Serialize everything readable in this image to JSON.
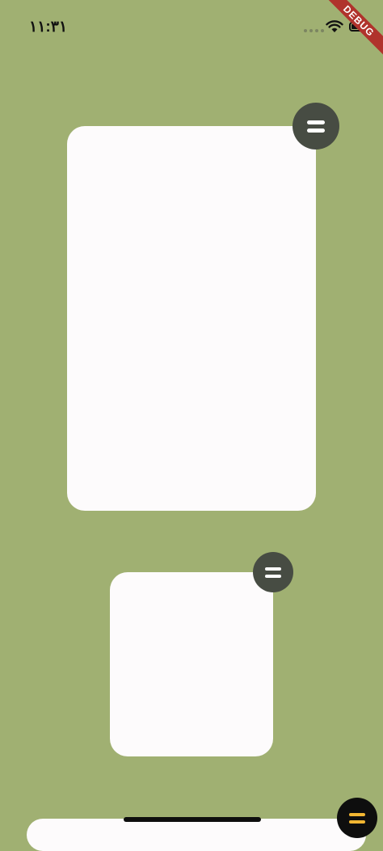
{
  "status_bar": {
    "time": "١١:٣١",
    "signal_icon": "cellular-dots-icon",
    "wifi_icon": "wifi-icon",
    "battery_icon": "battery-icon"
  },
  "debug_banner": {
    "label": "DEBUG"
  },
  "cards": [
    {
      "name": "large-card",
      "handle_icon": "drag-handle-icon"
    },
    {
      "name": "small-card",
      "handle_icon": "drag-handle-icon"
    },
    {
      "name": "bottom-card",
      "handle_icon": "drag-handle-icon"
    }
  ],
  "colors": {
    "background": "#a0b072",
    "card": "#fdfbfc",
    "handle": "#474c43",
    "handle_active": "#0e0e0e",
    "handle_active_bars": "#f2b632",
    "debug_banner": "#b0332c"
  }
}
